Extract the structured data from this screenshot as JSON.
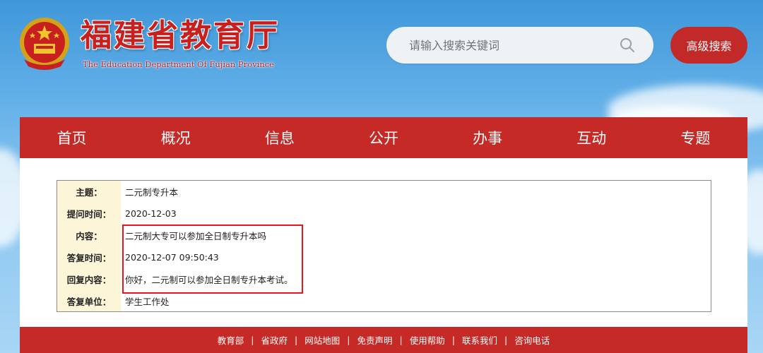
{
  "header": {
    "title": "福建省教育厅",
    "subtitle": "The Education Department Of Fujian Province"
  },
  "search": {
    "placeholder": "请输入搜索关键词",
    "advanced_label": "高级搜索"
  },
  "nav": {
    "items": [
      "首页",
      "概况",
      "信息",
      "公开",
      "办事",
      "互动",
      "专题"
    ]
  },
  "detail": {
    "rows": [
      {
        "label": "主题：",
        "value": "二元制专升本"
      },
      {
        "label": "提问时间：",
        "value": "2020-12-03"
      },
      {
        "label": "内容：",
        "value": "二元制大专可以参加全日制专升本吗"
      },
      {
        "label": "答复时间：",
        "value": "2020-12-07 09:50:43"
      },
      {
        "label": "回复内容：",
        "value": "你好，二元制可以参加全日制专升本考试。"
      },
      {
        "label": "答复单位：",
        "value": "学生工作处"
      }
    ]
  },
  "footer": {
    "links": [
      "教育部",
      "省政府",
      "网站地图",
      "免责声明",
      "使用帮助",
      "联系我们",
      "咨询电话"
    ],
    "separator": "|"
  },
  "colors": {
    "brand_red": "#c52a26",
    "highlight_red": "#e8141e",
    "label_bg": "#fdf5d8"
  }
}
